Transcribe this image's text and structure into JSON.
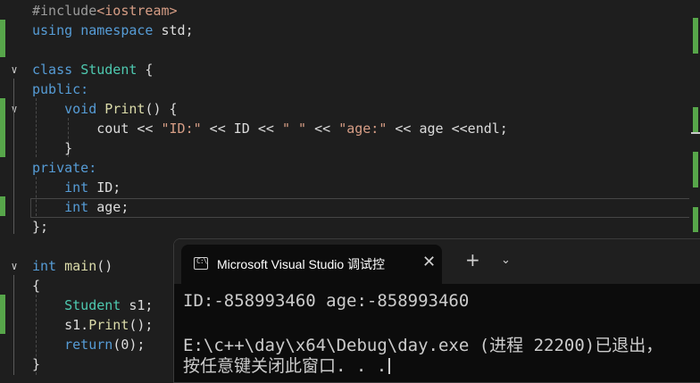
{
  "editor": {
    "lines": {
      "l1_pre": "#include",
      "l1_lt": "<",
      "l1_hdr": "iostream",
      "l1_gt": ">",
      "l2_using": "using",
      "l2_ns": "namespace",
      "l2_std": " std;",
      "l4_class": "class",
      "l4_name": "Student",
      "l4_brace": " {",
      "l5": "public:",
      "l6_void": "void",
      "l6_fn": "Print",
      "l6_rest": "() {",
      "l7_a": "cout << ",
      "l7_s1": "\"ID:\"",
      "l7_b": " << ID << ",
      "l7_s2": "\" \"",
      "l7_c": " << ",
      "l7_s3": "\"age:\"",
      "l7_d": " << age <<endl;",
      "l8": "}",
      "l9": "private:",
      "l10_int": "int",
      "l10_rest": " ID;",
      "l11_int": "int",
      "l11_rest": " age;",
      "l12": "};",
      "l14_int": "int",
      "l14_fn": "main",
      "l14_rest": "()",
      "l15": "{",
      "l16_ty": "Student",
      "l16_rest": " s1;",
      "l17_a": "s1.",
      "l17_fn": "Print",
      "l17_b": "();",
      "l18_kw": "return",
      "l18_rest": "(0);",
      "l19": "}"
    }
  },
  "terminal": {
    "tab_icon_glyph": "C:\\",
    "tab_title": "Microsoft Visual Studio 调试控",
    "close_glyph": "✕",
    "new_tab_glyph": "+",
    "dropdown_glyph": "⌄",
    "output_line1": "ID:-858993460 age:-858993460",
    "output_line2": "E:\\c++\\day\\x64\\Debug\\day.exe (进程 22200)已退出，",
    "output_line3": "按任意键关闭此窗口. . ."
  },
  "colors": {
    "editor_bg": "#1e1e1e",
    "keyword": "#569cd6",
    "type": "#4ec9b0",
    "function": "#dcdcaa",
    "string": "#d69d85",
    "change_bar": "#57a64a",
    "terminal_bg": "#0c0c0c"
  }
}
